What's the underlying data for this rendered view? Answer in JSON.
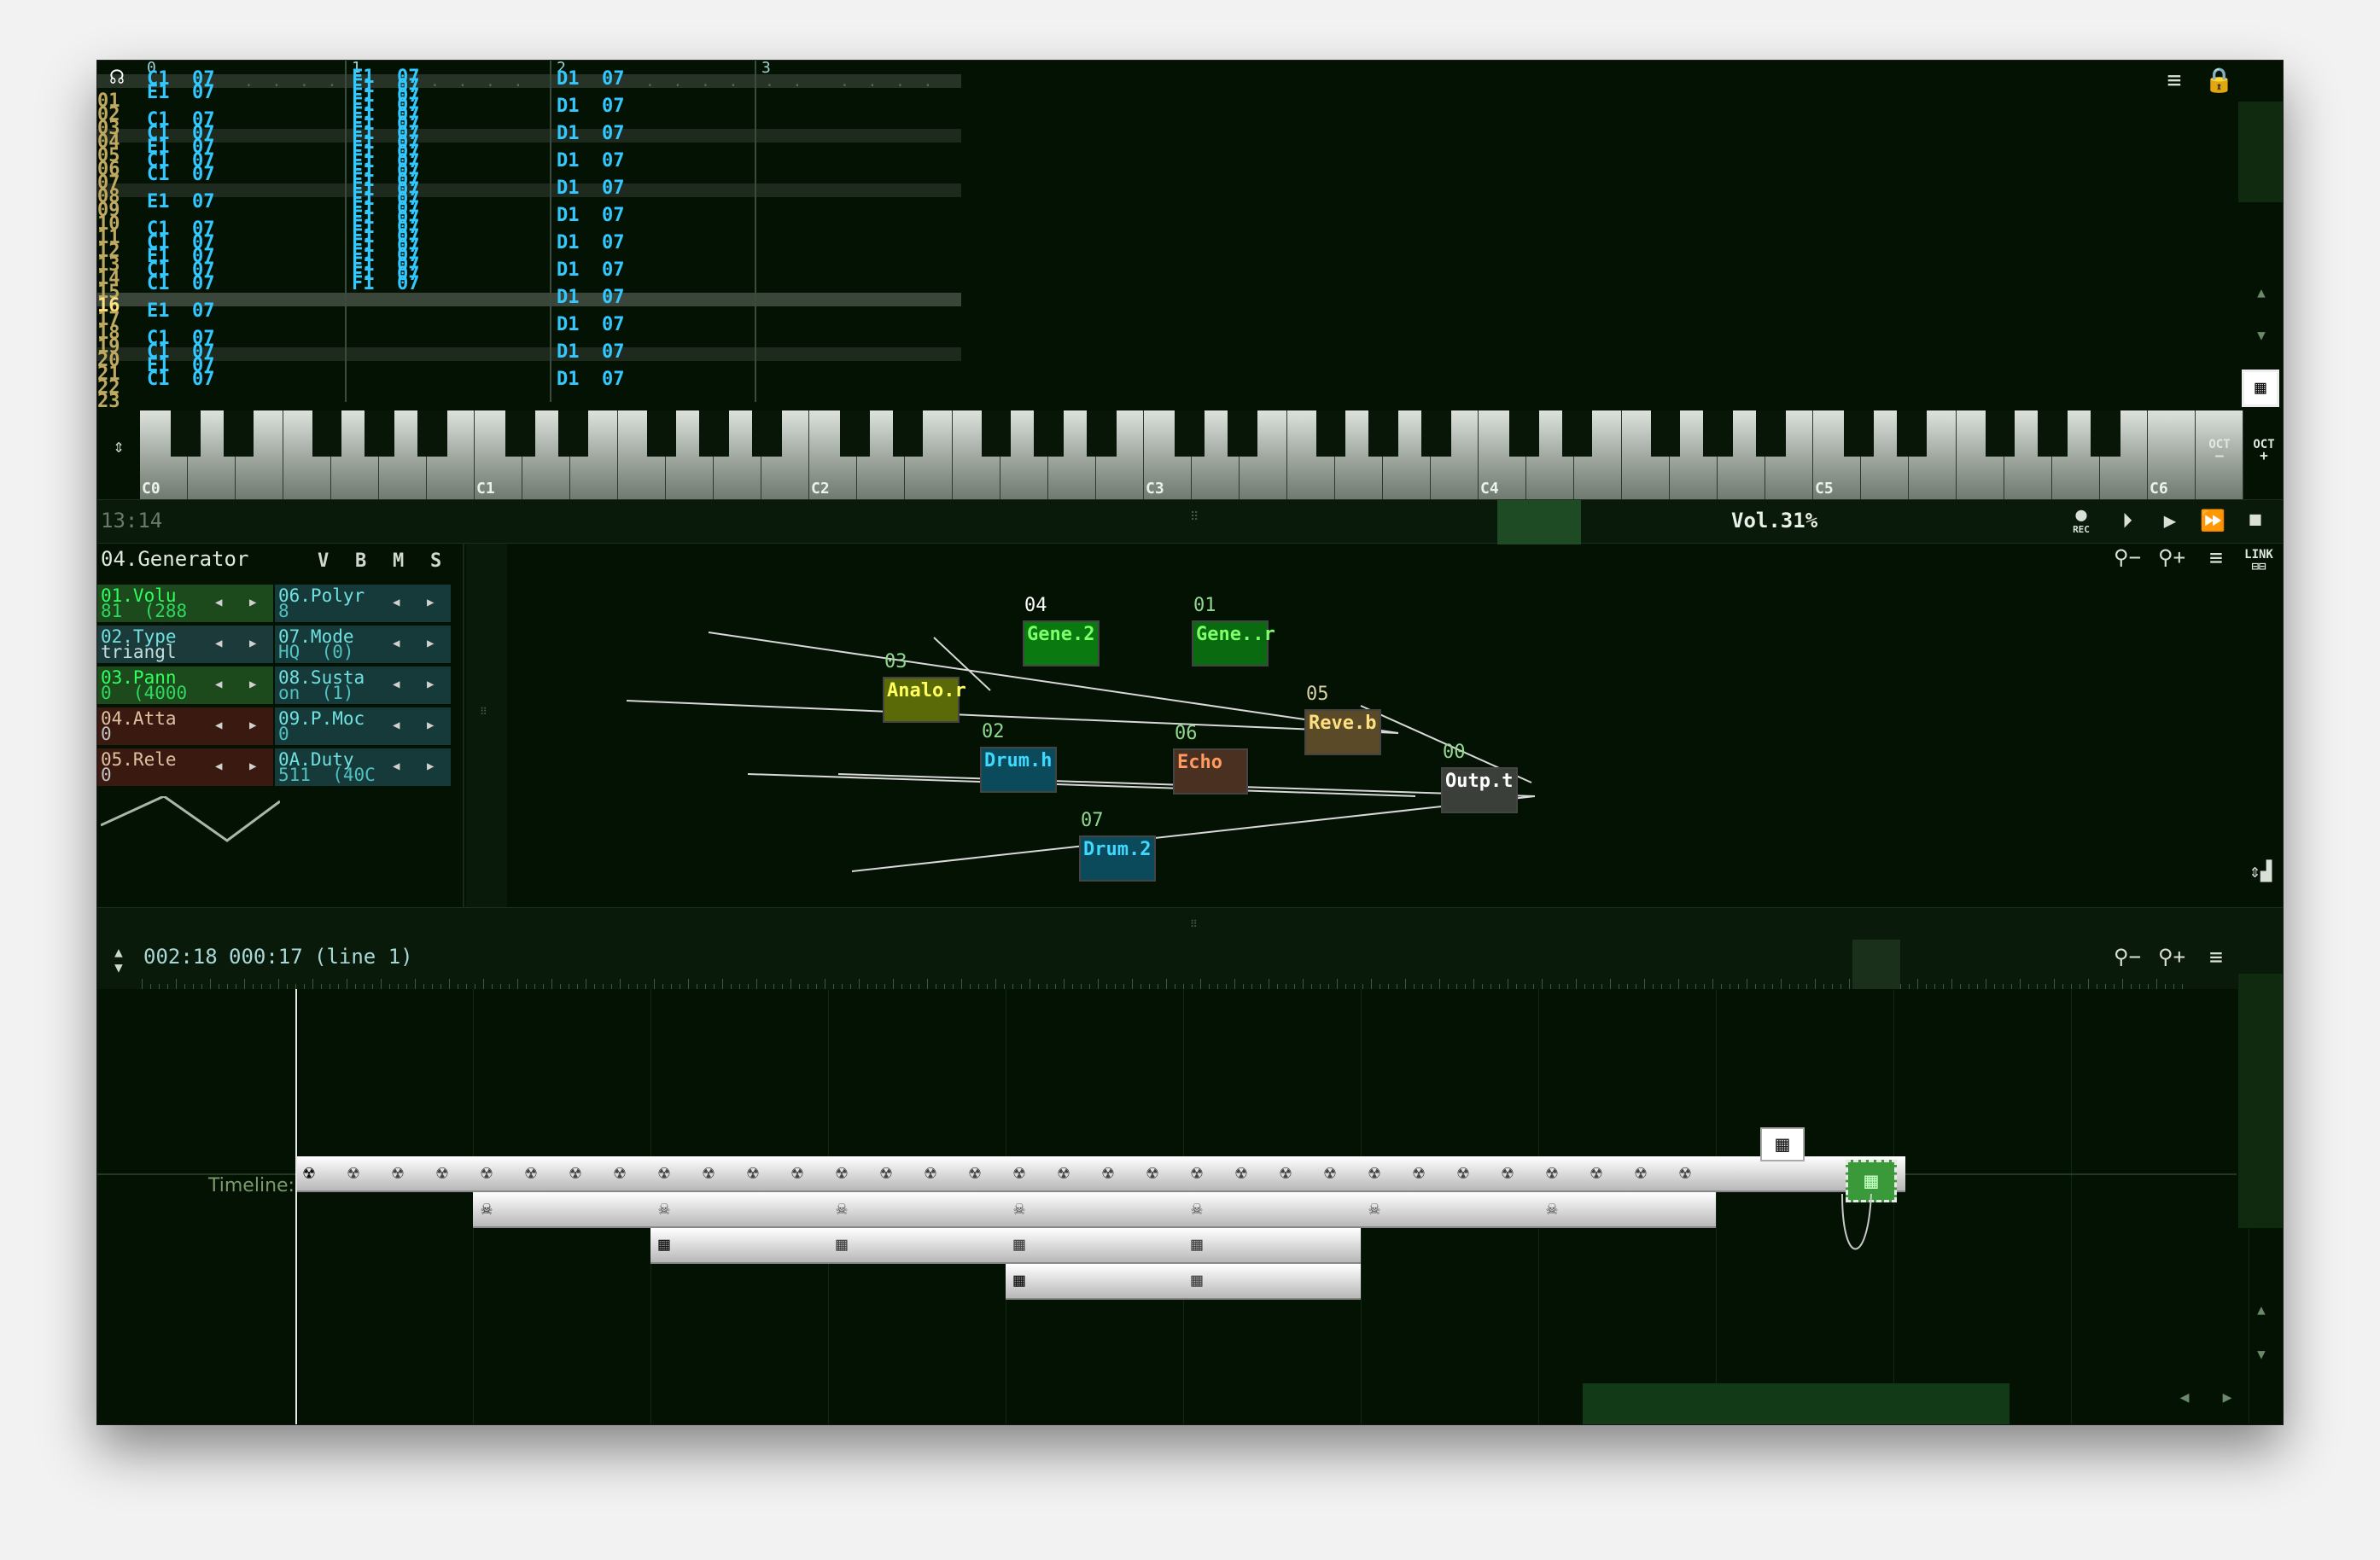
{
  "pattern_editor": {
    "row_numbers": [
      "01",
      "02",
      "03",
      "04",
      "05",
      "06",
      "07",
      "08",
      "09",
      "10",
      "11",
      "12",
      "13",
      "14",
      "15",
      "16",
      "17",
      "18",
      "19",
      "20",
      "21",
      "22",
      "23"
    ],
    "tracks": [
      {
        "number": "0",
        "lines": "C1  07\nE1  07\n\nC1  07\nC1  07\nE1  07\nC1  07\nC1  07\n\nE1  07\n\nC1  07\nC1  07\nE1  07\nC1  07\nC1  07\n\nE1  07\n\nC1  07\nC1  07\nE1  07\nC1  07"
      },
      {
        "number": "1",
        "lines": "F1  07\nF1  07\nF1  07\nF1  07\nF1  07\nF1  07\nF1  07\nF1  07\nF1  07\nF1  07\nF1  07\nF1  07\nF1  07\nF1  07\nF1  07\nF1  07\nF1  07\nF1  07\nF1  07\nF1  07\nF1  07\nF1  07\nF1  07"
      },
      {
        "number": "2",
        "lines": "D1  07\n\nD1  07\n\nD1  07\n\nD1  07\n\nD1  07\n\nD1  07\n\nD1  07\n\nD1  07\n\nD1  07\n\nD1  07\n\nD1  07\n\nD1  07"
      },
      {
        "number": "3",
        "lines": ""
      }
    ]
  },
  "piano": {
    "octave_labels": [
      "C0",
      "C1",
      "C2",
      "C3",
      "C4",
      "C5",
      "C6"
    ],
    "oct_down_label": "OCT",
    "oct_up_label": "OCT"
  },
  "transport": {
    "time": "13:14",
    "volume": "Vol.31%",
    "rec_label": "REC"
  },
  "module_panel": {
    "title": "04.Generator",
    "flags": [
      "V",
      "B",
      "M",
      "S"
    ],
    "params": [
      {
        "name": "01.Volu",
        "value": "81  (288",
        "color": "green"
      },
      {
        "name": "06.Polyr",
        "value": "8",
        "color": "teal"
      },
      {
        "name": "02.Type",
        "value": "triangl",
        "color": "teal2"
      },
      {
        "name": "07.Mode",
        "value": "HQ  (0)",
        "color": "teal"
      },
      {
        "name": "03.Pann",
        "value": "0  (4000",
        "color": "green"
      },
      {
        "name": "08.Susta",
        "value": "on  (1)",
        "color": "teal"
      },
      {
        "name": "04.Atta",
        "value": "0",
        "color": "red"
      },
      {
        "name": "09.P.Moc",
        "value": "0",
        "color": "teal"
      },
      {
        "name": "05.Rele",
        "value": "0",
        "color": "red"
      },
      {
        "name": "0A.Duty",
        "value": "511  (40C",
        "color": "teal"
      }
    ]
  },
  "graph": {
    "link_label": "LINK",
    "nodes": [
      {
        "id": "04",
        "label": "Gene.2",
        "color": "#0a7a10",
        "text": "#7dff6a"
      },
      {
        "id": "01",
        "label": "Gene..r",
        "color": "#0a6a10",
        "text": "#7dff6a"
      },
      {
        "id": "03",
        "label": "Analo.r",
        "color": "#5a6a08",
        "text": "#ffff60"
      },
      {
        "id": "05",
        "label": "Reve.b",
        "color": "#5a4a28",
        "text": "#ffe080"
      },
      {
        "id": "02",
        "label": "Drum.h",
        "color": "#0a4a5a",
        "text": "#40d8ff"
      },
      {
        "id": "06",
        "label": "Echo",
        "color": "#4a3020",
        "text": "#ff9a60"
      },
      {
        "id": "00",
        "label": "Outp.t",
        "color": "#3a3f3a",
        "text": "#ffffff"
      },
      {
        "id": "07",
        "label": "Drum.2",
        "color": "#0a4a5a",
        "text": "#40d8ff"
      }
    ]
  },
  "timeline": {
    "position": "002:18",
    "pattern_time": "000:17",
    "line_info": "(line 1)",
    "label": "Timeline:"
  }
}
